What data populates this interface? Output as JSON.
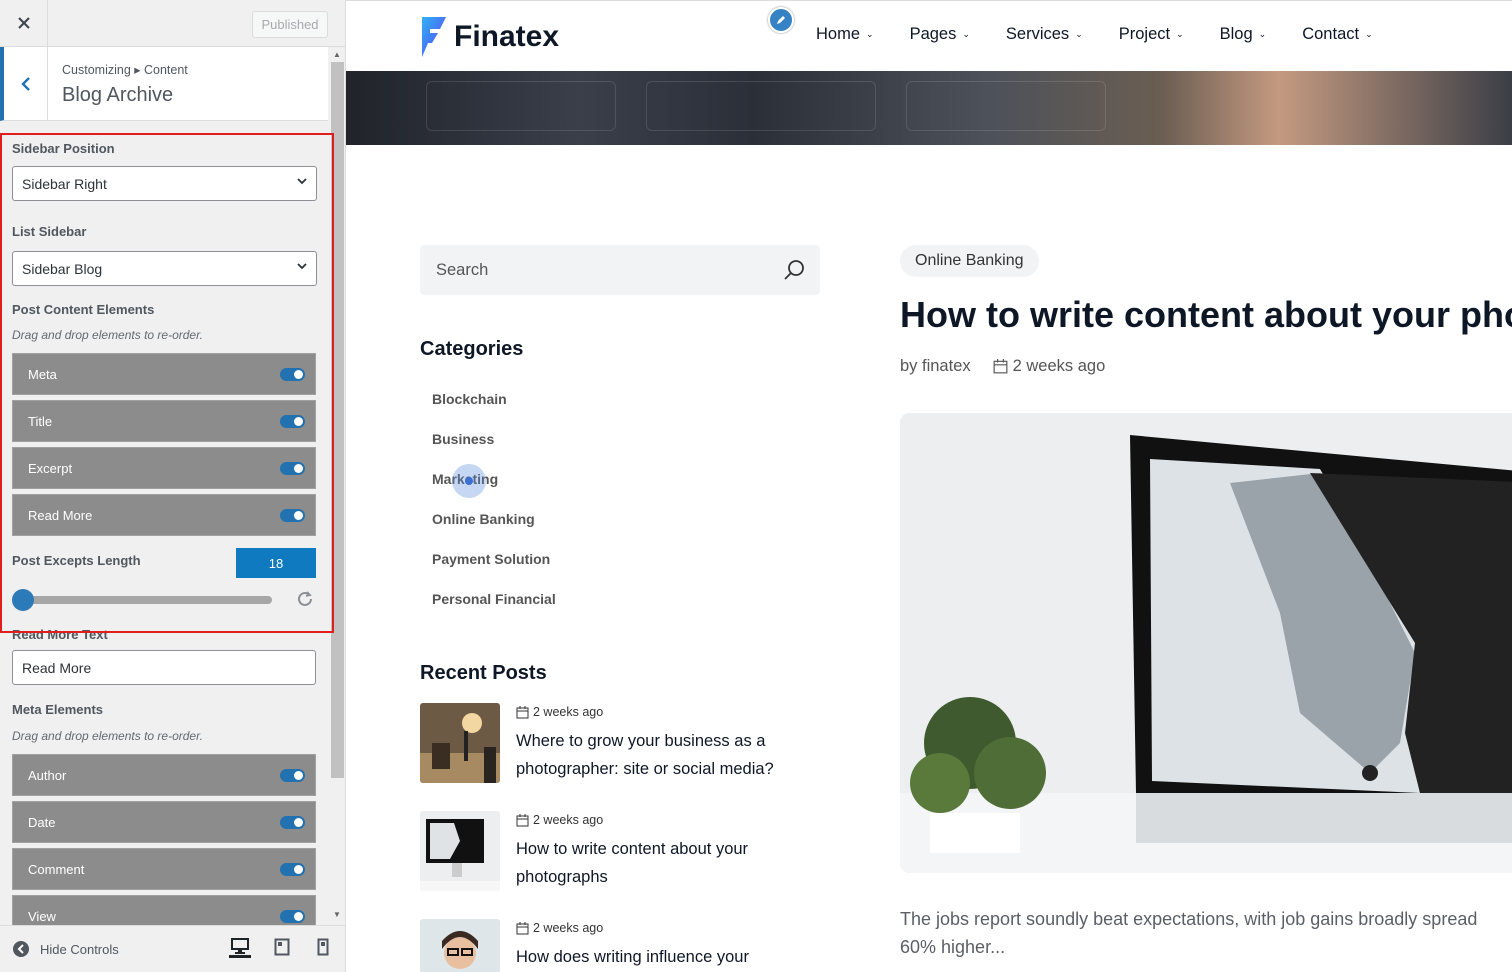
{
  "customizer": {
    "close_icon": "close-icon",
    "published_label": "Published",
    "breadcrumb": "Customizing ▸ Content",
    "section_title": "Blog Archive",
    "sidebar_position": {
      "label": "Sidebar Position",
      "value": "Sidebar Right"
    },
    "list_sidebar": {
      "label": "List Sidebar",
      "value": "Sidebar Blog"
    },
    "post_content_elements": {
      "label": "Post Content Elements",
      "desc": "Drag and drop elements to re-order.",
      "items": [
        {
          "label": "Meta",
          "enabled": true
        },
        {
          "label": "Title",
          "enabled": true
        },
        {
          "label": "Excerpt",
          "enabled": true
        },
        {
          "label": "Read More",
          "enabled": true
        }
      ]
    },
    "excerpt_length": {
      "label": "Post Excepts Length",
      "value": "18"
    },
    "read_more_text": {
      "label": "Read More Text",
      "value": "Read More"
    },
    "meta_elements": {
      "label": "Meta Elements",
      "desc": "Drag and drop elements to re-order.",
      "items": [
        {
          "label": "Author",
          "enabled": true
        },
        {
          "label": "Date",
          "enabled": true
        },
        {
          "label": "Comment",
          "enabled": true
        },
        {
          "label": "View",
          "enabled": true
        }
      ]
    },
    "footer": {
      "hide_controls": "Hide Controls"
    }
  },
  "site": {
    "logo_text": "Finatex",
    "nav": [
      "Home",
      "Pages",
      "Services",
      "Project",
      "Blog",
      "Contact"
    ],
    "search_placeholder": "Search",
    "categories_title": "Categories",
    "categories": [
      "Blockchain",
      "Business",
      "Marketing",
      "Online Banking",
      "Payment Solution",
      "Personal Financial"
    ],
    "recent_posts_title": "Recent Posts",
    "recent_posts": [
      {
        "date": "2 weeks ago",
        "title": "Where to grow your business as a photographer: site or social media?"
      },
      {
        "date": "2 weeks ago",
        "title": "How to write content about your photographs"
      },
      {
        "date": "2 weeks ago",
        "title": "How does writing influence your"
      }
    ],
    "post": {
      "category": "Online Banking",
      "title": "How to write content about your photographs",
      "author": "by finatex",
      "date": "2 weeks ago",
      "excerpt_line1": "The jobs report soundly beat expectations, with job gains broadly spread",
      "excerpt_line2": "60% higher..."
    }
  },
  "colors": {
    "accent": "#2271b1",
    "highlight": "#e01e1e",
    "brand": "#0e1726"
  }
}
